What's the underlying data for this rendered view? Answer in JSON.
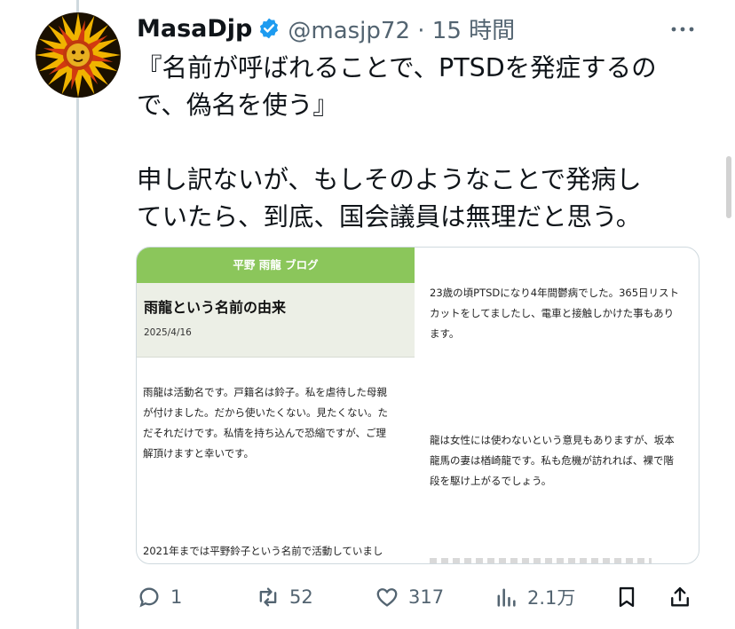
{
  "tweet": {
    "display_name": "MasaDjp",
    "handle_time": "@masjp72 · 15 時間",
    "text_lines": [
      "『名前が呼ばれることで、PTSDを発症するの",
      "で、偽名を使う』",
      "申し訳ないが、もしそのようなことで発病し",
      "ていたら、到底、国会議員は無理だと思う。"
    ]
  },
  "card": {
    "blog_name": "平野 雨龍 ブログ",
    "post_title": "雨龍という名前の由来",
    "post_date": "2025/4/16",
    "left_para1": [
      "雨龍は活動名です。戸籍名は鈴子。私を虐待した母親",
      "が付けました。だから使いたくない。見たくない。た",
      "だそれだけです。私情を持ち込んで恐縮ですが、ご理",
      "解頂けますと幸いです。"
    ],
    "left_para2": "2021年までは平野鈴子という名前で活動していまし",
    "right_para1": [
      "23歳の頃PTSDになり4年間鬱病でした。365日リスト",
      "カットをしてましたし、電車と接触しかけた事もあり",
      "ます。"
    ],
    "right_para2": [
      "龍は女性には使わないという意見もありますが、坂本",
      "龍馬の妻は楢崎龍です。私も危機が訪れれば、裸で階",
      "段を駆け上がるでしょう。"
    ]
  },
  "actions": {
    "replies": "1",
    "reposts": "52",
    "likes": "317",
    "views": "2.1万"
  },
  "colors": {
    "text": "#0f1419",
    "secondary": "#536471",
    "verified": "#1d9bf0",
    "blog_green": "#8bc65b"
  }
}
